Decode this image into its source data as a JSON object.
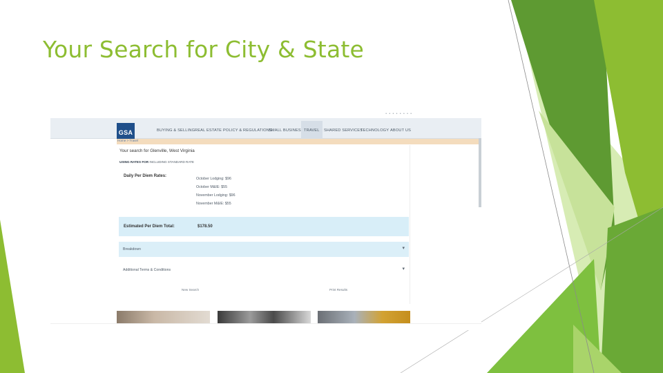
{
  "slide": {
    "title": "Your Search for City & State",
    "colors": {
      "accent_green": "#8dbd32",
      "dark_green": "#4f8f2a",
      "mid_green": "#7ab63a",
      "pale_green": "#cfe7a8"
    }
  },
  "screenshot": {
    "logo_text": "GSA",
    "nav": [
      {
        "label": "BUYING & SELLING"
      },
      {
        "label": "REAL ESTATE"
      },
      {
        "label": "POLICY & REGULATIONS"
      },
      {
        "label": "SMALL BUSINESS"
      },
      {
        "label": "TRAVEL",
        "active": true
      },
      {
        "label": "SHARED SERVICES"
      },
      {
        "label": "TECHNOLOGY"
      },
      {
        "label": "ABOUT US"
      }
    ],
    "breadcrumb": "Home > Travel",
    "search_summary": "Your search for Glenville, West Virginia",
    "rates_line_prefix": "USING RATES FOR",
    "rates_line_suffix": "INCLUDING STANDARD RATE",
    "daily_label": "Daily Per Diem Rates:",
    "rates": [
      "October Lodging: $96",
      "October M&IE: $55",
      "November Lodging: $96",
      "November M&IE: $55"
    ],
    "total_label": "Estimated Per Diem Total:",
    "total_value": "$178.50",
    "breakdown_label": "Breakdown",
    "terms_label": "Additional Terms & Conditions",
    "new_search_label": "New Search",
    "print_results_label": "Print Results",
    "chevron_icon": "chevron-down-icon"
  }
}
